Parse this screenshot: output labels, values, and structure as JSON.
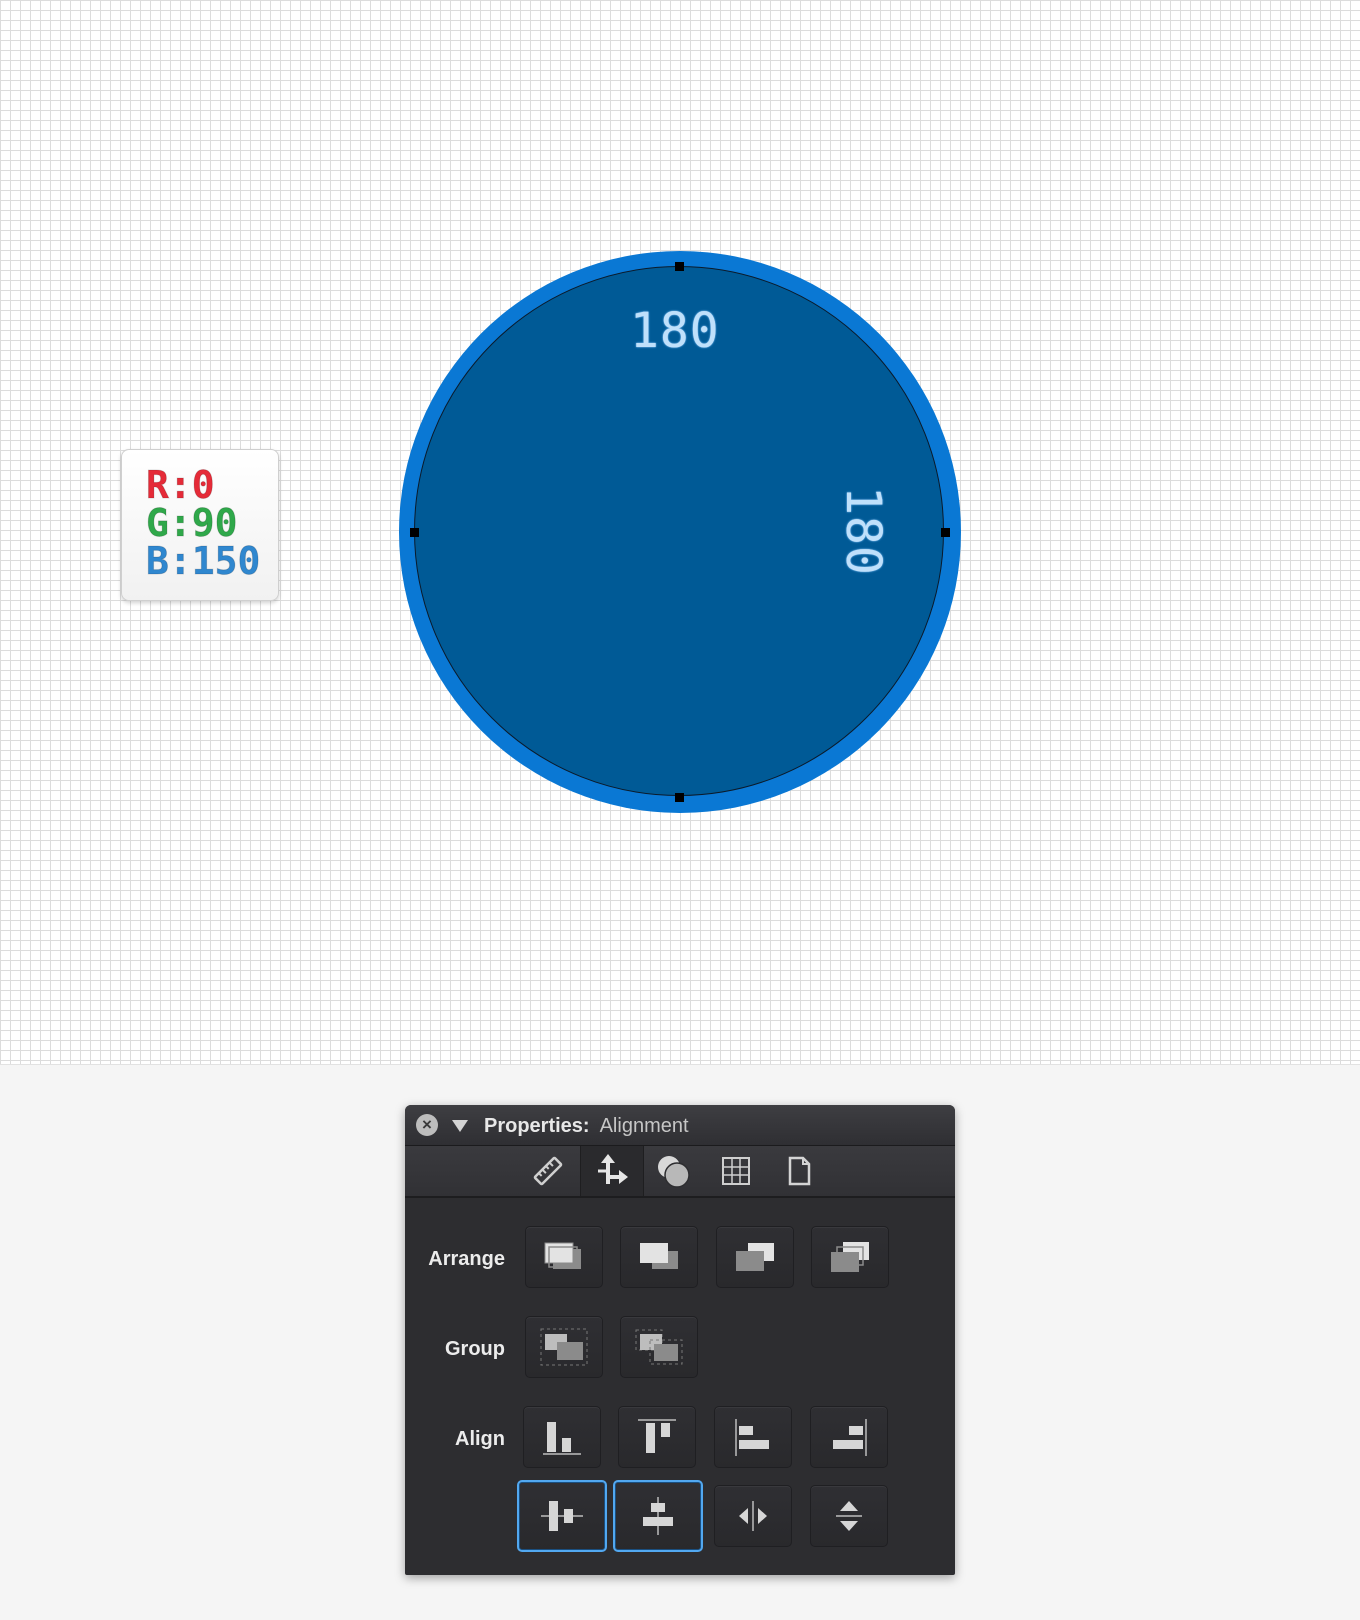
{
  "canvas": {
    "circle_fill": "#005a96",
    "circle_stroke": "#0a78d4",
    "width_label": "180",
    "height_label": "180"
  },
  "color_sticker": {
    "r": "R:0",
    "g": "G:90",
    "b": "B:150",
    "r_color": "#e52b38",
    "g_color": "#2fa84a",
    "b_color": "#2f87cf"
  },
  "panel": {
    "title_bold": "Properties:",
    "title_section": "Alignment",
    "close_icon": "close-icon",
    "tabs": [
      {
        "icon": "ruler-icon",
        "active": false
      },
      {
        "icon": "move-arrows-icon",
        "active": true
      },
      {
        "icon": "shapes-overlap-icon",
        "active": false
      },
      {
        "icon": "grid-icon",
        "active": false
      },
      {
        "icon": "document-icon",
        "active": false
      }
    ],
    "rows": {
      "arrange": {
        "label": "Arrange",
        "buttons": [
          "bring-to-front-icon",
          "bring-forward-icon",
          "send-backward-icon",
          "send-to-back-icon"
        ]
      },
      "group": {
        "label": "Group",
        "buttons": [
          "group-icon",
          "ungroup-icon"
        ]
      },
      "align": {
        "label": "Align",
        "buttons": [
          "align-bottom-icon",
          "align-top-icon",
          "align-left-icon",
          "align-right-icon",
          "align-horizontal-center-icon",
          "align-vertical-center-icon",
          "distribute-horizontal-icon",
          "distribute-vertical-icon"
        ],
        "selected": [
          "align-horizontal-center-icon",
          "align-vertical-center-icon"
        ]
      }
    },
    "accent_color": "#52a8f0"
  }
}
